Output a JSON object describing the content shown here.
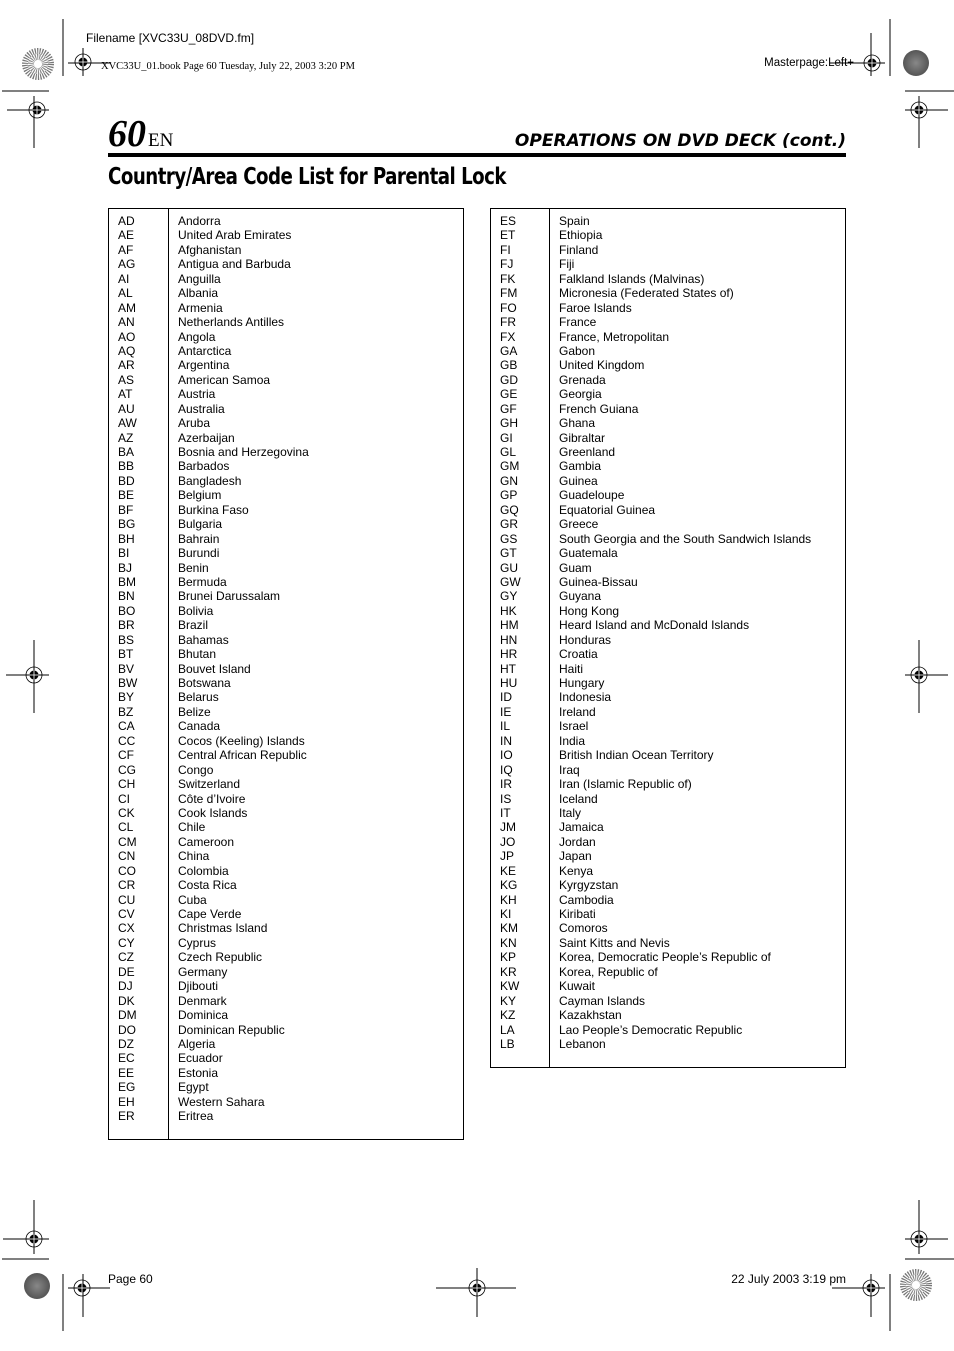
{
  "header": {
    "filename": "Filename [XVC33U_08DVD.fm]",
    "book_line": "XVC33U_01.book  Page 60  Tuesday, July 22, 2003  3:20 PM",
    "masterpage": "Masterpage:Left+",
    "page_number": "60",
    "page_lang": "EN",
    "section_title": "OPERATIONS ON DVD DECK (cont.)"
  },
  "title": "Country/Area Code List for Parental Lock",
  "left_table": [
    {
      "code": "AD",
      "name": "Andorra"
    },
    {
      "code": "AE",
      "name": "United Arab Emirates"
    },
    {
      "code": "AF",
      "name": "Afghanistan"
    },
    {
      "code": "AG",
      "name": "Antigua and Barbuda"
    },
    {
      "code": "AI",
      "name": "Anguilla"
    },
    {
      "code": "AL",
      "name": "Albania"
    },
    {
      "code": "AM",
      "name": "Armenia"
    },
    {
      "code": "AN",
      "name": "Netherlands Antilles"
    },
    {
      "code": "AO",
      "name": "Angola"
    },
    {
      "code": "AQ",
      "name": "Antarctica"
    },
    {
      "code": "AR",
      "name": "Argentina"
    },
    {
      "code": "AS",
      "name": "American Samoa"
    },
    {
      "code": "AT",
      "name": "Austria"
    },
    {
      "code": "AU",
      "name": "Australia"
    },
    {
      "code": "AW",
      "name": "Aruba"
    },
    {
      "code": "AZ",
      "name": "Azerbaijan"
    },
    {
      "code": "BA",
      "name": "Bosnia and Herzegovina"
    },
    {
      "code": "BB",
      "name": "Barbados"
    },
    {
      "code": "BD",
      "name": "Bangladesh"
    },
    {
      "code": "BE",
      "name": "Belgium"
    },
    {
      "code": "BF",
      "name": "Burkina Faso"
    },
    {
      "code": "BG",
      "name": "Bulgaria"
    },
    {
      "code": "BH",
      "name": "Bahrain"
    },
    {
      "code": "BI",
      "name": "Burundi"
    },
    {
      "code": "BJ",
      "name": "Benin"
    },
    {
      "code": "BM",
      "name": "Bermuda"
    },
    {
      "code": "BN",
      "name": "Brunei Darussalam"
    },
    {
      "code": "BO",
      "name": "Bolivia"
    },
    {
      "code": "BR",
      "name": "Brazil"
    },
    {
      "code": "BS",
      "name": "Bahamas"
    },
    {
      "code": "BT",
      "name": "Bhutan"
    },
    {
      "code": "BV",
      "name": "Bouvet Island"
    },
    {
      "code": "BW",
      "name": "Botswana"
    },
    {
      "code": "BY",
      "name": "Belarus"
    },
    {
      "code": "BZ",
      "name": "Belize"
    },
    {
      "code": "CA",
      "name": "Canada"
    },
    {
      "code": "CC",
      "name": "Cocos (Keeling) Islands"
    },
    {
      "code": "CF",
      "name": "Central African Republic"
    },
    {
      "code": "CG",
      "name": "Congo"
    },
    {
      "code": "CH",
      "name": "Switzerland"
    },
    {
      "code": "CI",
      "name": "Côte d’Ivoire"
    },
    {
      "code": "CK",
      "name": "Cook Islands"
    },
    {
      "code": "CL",
      "name": "Chile"
    },
    {
      "code": "CM",
      "name": "Cameroon"
    },
    {
      "code": "CN",
      "name": "China"
    },
    {
      "code": "CO",
      "name": "Colombia"
    },
    {
      "code": "CR",
      "name": "Costa Rica"
    },
    {
      "code": "CU",
      "name": "Cuba"
    },
    {
      "code": "CV",
      "name": "Cape Verde"
    },
    {
      "code": "CX",
      "name": "Christmas Island"
    },
    {
      "code": "CY",
      "name": "Cyprus"
    },
    {
      "code": "CZ",
      "name": "Czech Republic"
    },
    {
      "code": "DE",
      "name": "Germany"
    },
    {
      "code": "DJ",
      "name": "Djibouti"
    },
    {
      "code": "DK",
      "name": "Denmark"
    },
    {
      "code": "DM",
      "name": "Dominica"
    },
    {
      "code": "DO",
      "name": "Dominican Republic"
    },
    {
      "code": "DZ",
      "name": "Algeria"
    },
    {
      "code": "EC",
      "name": "Ecuador"
    },
    {
      "code": "EE",
      "name": "Estonia"
    },
    {
      "code": "EG",
      "name": "Egypt"
    },
    {
      "code": "EH",
      "name": "Western Sahara"
    },
    {
      "code": "ER",
      "name": "Eritrea"
    }
  ],
  "right_table": [
    {
      "code": "ES",
      "name": "Spain"
    },
    {
      "code": "ET",
      "name": "Ethiopia"
    },
    {
      "code": "FI",
      "name": "Finland"
    },
    {
      "code": "FJ",
      "name": "Fiji"
    },
    {
      "code": "FK",
      "name": "Falkland Islands (Malvinas)"
    },
    {
      "code": "FM",
      "name": "Micronesia (Federated States of)"
    },
    {
      "code": "FO",
      "name": "Faroe Islands"
    },
    {
      "code": "FR",
      "name": "France"
    },
    {
      "code": "FX",
      "name": "France, Metropolitan"
    },
    {
      "code": "GA",
      "name": "Gabon"
    },
    {
      "code": "GB",
      "name": "United Kingdom"
    },
    {
      "code": "GD",
      "name": "Grenada"
    },
    {
      "code": "GE",
      "name": "Georgia"
    },
    {
      "code": "GF",
      "name": "French Guiana"
    },
    {
      "code": "GH",
      "name": "Ghana"
    },
    {
      "code": "GI",
      "name": "Gibraltar"
    },
    {
      "code": "GL",
      "name": "Greenland"
    },
    {
      "code": "GM",
      "name": "Gambia"
    },
    {
      "code": "GN",
      "name": "Guinea"
    },
    {
      "code": "GP",
      "name": "Guadeloupe"
    },
    {
      "code": "GQ",
      "name": "Equatorial Guinea"
    },
    {
      "code": "GR",
      "name": "Greece"
    },
    {
      "code": "GS",
      "name": "South Georgia and the South Sandwich Islands"
    },
    {
      "code": "GT",
      "name": "Guatemala"
    },
    {
      "code": "GU",
      "name": "Guam"
    },
    {
      "code": "GW",
      "name": "Guinea-Bissau"
    },
    {
      "code": "GY",
      "name": "Guyana"
    },
    {
      "code": "HK",
      "name": "Hong Kong"
    },
    {
      "code": "HM",
      "name": "Heard Island and McDonald Islands"
    },
    {
      "code": "HN",
      "name": "Honduras"
    },
    {
      "code": "HR",
      "name": "Croatia"
    },
    {
      "code": "HT",
      "name": "Haiti"
    },
    {
      "code": "HU",
      "name": "Hungary"
    },
    {
      "code": "ID",
      "name": "Indonesia"
    },
    {
      "code": "IE",
      "name": "Ireland"
    },
    {
      "code": "IL",
      "name": "Israel"
    },
    {
      "code": "IN",
      "name": "India"
    },
    {
      "code": "IO",
      "name": "British Indian Ocean Territory"
    },
    {
      "code": "IQ",
      "name": "Iraq"
    },
    {
      "code": "IR",
      "name": "Iran (Islamic Republic of)"
    },
    {
      "code": "IS",
      "name": "Iceland"
    },
    {
      "code": "IT",
      "name": "Italy"
    },
    {
      "code": "JM",
      "name": "Jamaica"
    },
    {
      "code": "JO",
      "name": "Jordan"
    },
    {
      "code": "JP",
      "name": "Japan"
    },
    {
      "code": "KE",
      "name": "Kenya"
    },
    {
      "code": "KG",
      "name": "Kyrgyzstan"
    },
    {
      "code": "KH",
      "name": "Cambodia"
    },
    {
      "code": "KI",
      "name": "Kiribati"
    },
    {
      "code": "KM",
      "name": "Comoros"
    },
    {
      "code": "KN",
      "name": "Saint Kitts and Nevis"
    },
    {
      "code": "KP",
      "name": "Korea, Democratic People’s Republic of"
    },
    {
      "code": "KR",
      "name": "Korea, Republic of"
    },
    {
      "code": "KW",
      "name": "Kuwait"
    },
    {
      "code": "KY",
      "name": "Cayman Islands"
    },
    {
      "code": "KZ",
      "name": "Kazakhstan"
    },
    {
      "code": "LA",
      "name": "Lao People’s Democratic Republic"
    },
    {
      "code": "LB",
      "name": "Lebanon"
    }
  ],
  "footer": {
    "page_label": "Page 60",
    "timestamp": "22 July 2003 3:19 pm"
  }
}
